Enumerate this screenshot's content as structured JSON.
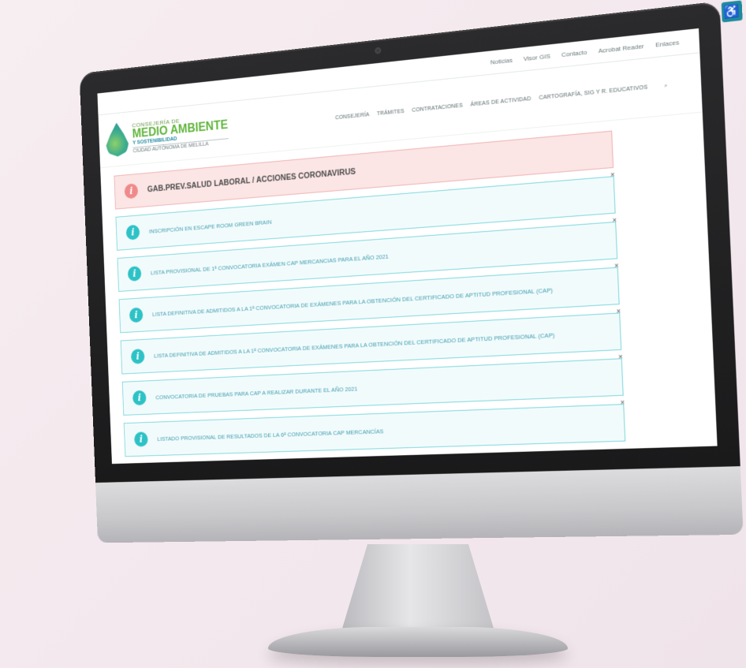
{
  "topbar": {
    "links": [
      "Noticias",
      "Visor GIS",
      "Contacto",
      "Acrobat Reader",
      "Enlaces"
    ]
  },
  "logo": {
    "line1": "CONSEJERÍA DE",
    "line2": "MEDIO AMBIENTE",
    "line3": "Y SOSTENIBILIDAD",
    "line4": "CIUDAD AUTÓNOMA DE MELILLA"
  },
  "nav": {
    "items": [
      "CONSEJERÍA",
      "TRÁMITES",
      "CONTRATACIONES",
      "ÁREAS DE ACTIVIDAD",
      "CARTOGRAFÍA, SIG Y R. EDUCATIVOS"
    ]
  },
  "alerts": [
    {
      "type": "danger",
      "text": "GAB.PREV.SALUD LABORAL / ACCIONES CORONAVIRUS"
    },
    {
      "type": "info",
      "text": "INSCRIPCIÓN EN ESCAPE ROOM GREEN BRAIN"
    },
    {
      "type": "info",
      "text": "LISTA PROVISIONAL DE 1ª CONVOCATORIA EXÁMEN CAP MERCANCIAS PARA EL AÑO 2021"
    },
    {
      "type": "info",
      "text": "LISTA DEFINITIVA DE ADMITIDOS A LA 1ª CONVOCATORIA DE EXÁMENES PARA LA OBTENCIÓN DEL CERTIFICADO DE APTITUD PROFESIONAL (CAP)"
    },
    {
      "type": "info",
      "text": "LISTA DEFINITIVA DE ADMITIDOS A LA 1ª CONVOCATORIA DE EXÁMENES PARA LA OBTENCIÓN DEL CERTIFICADO DE APTITUD PROFESIONAL (CAP)"
    },
    {
      "type": "info",
      "text": "CONVOCATORIA DE PRUEBAS PARA CAP A REALIZAR DURANTE EL AÑO 2021"
    },
    {
      "type": "info",
      "text": "LISTADO PROVISIONAL DE RESULTADOS DE LA 6ª CONVOCATORIA CAP MERCANCÍAS"
    }
  ],
  "icons": {
    "info": "i",
    "close": "×",
    "search": "⌕",
    "accessibility": "♿"
  },
  "colors": {
    "brand_green": "#5fb53b",
    "brand_teal": "#2b8ea6",
    "info_accent": "#2dc2c6",
    "danger_accent": "#ef8a8a"
  }
}
